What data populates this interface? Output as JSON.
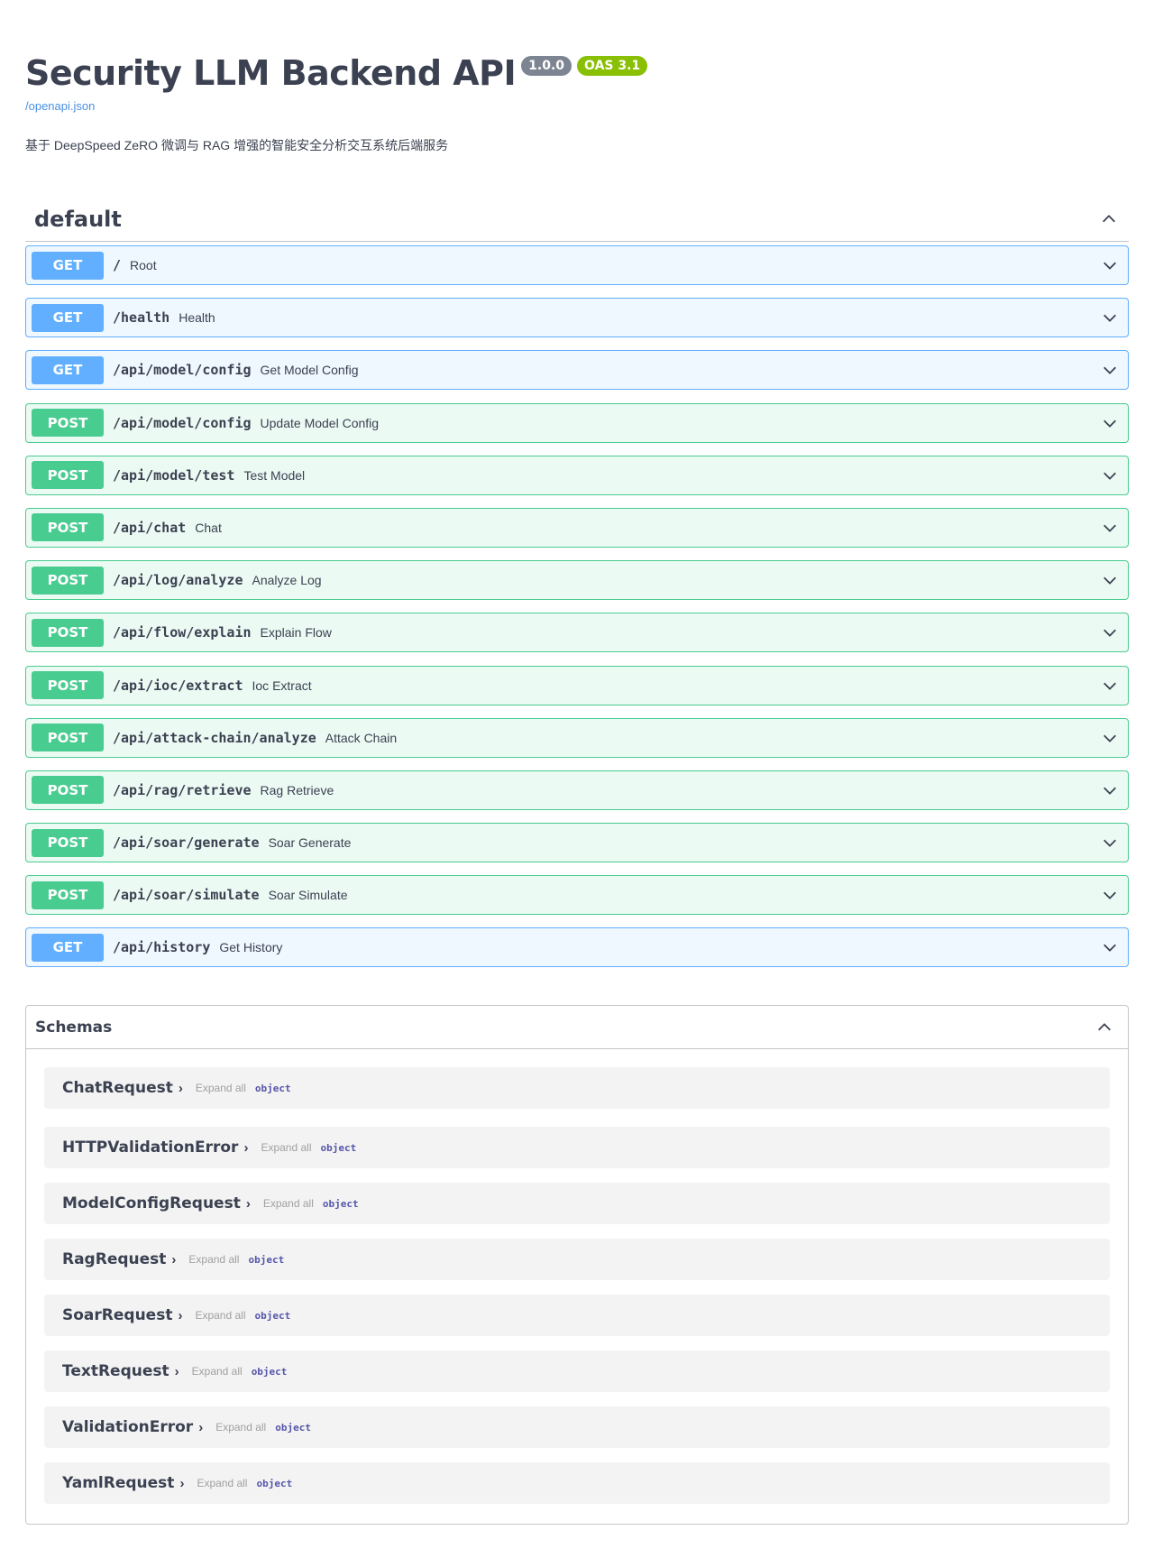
{
  "info": {
    "title": "Security LLM Backend API",
    "version": "1.0.0",
    "oas": "OAS 3.1",
    "openapi_link": "/openapi.json",
    "description": "基于 DeepSpeed ZeRO 微调与 RAG 增强的智能安全分析交互系统后端服务"
  },
  "tag": {
    "name": "default"
  },
  "operations": [
    {
      "method": "GET",
      "path": "/",
      "summary": "Root"
    },
    {
      "method": "GET",
      "path": "/health",
      "summary": "Health"
    },
    {
      "method": "GET",
      "path": "/api/model/config",
      "summary": "Get Model Config"
    },
    {
      "method": "POST",
      "path": "/api/model/config",
      "summary": "Update Model Config"
    },
    {
      "method": "POST",
      "path": "/api/model/test",
      "summary": "Test Model"
    },
    {
      "method": "POST",
      "path": "/api/chat",
      "summary": "Chat"
    },
    {
      "method": "POST",
      "path": "/api/log/analyze",
      "summary": "Analyze Log"
    },
    {
      "method": "POST",
      "path": "/api/flow/explain",
      "summary": "Explain Flow"
    },
    {
      "method": "POST",
      "path": "/api/ioc/extract",
      "summary": "Ioc Extract"
    },
    {
      "method": "POST",
      "path": "/api/attack-chain/analyze",
      "summary": "Attack Chain"
    },
    {
      "method": "POST",
      "path": "/api/rag/retrieve",
      "summary": "Rag Retrieve"
    },
    {
      "method": "POST",
      "path": "/api/soar/generate",
      "summary": "Soar Generate"
    },
    {
      "method": "POST",
      "path": "/api/soar/simulate",
      "summary": "Soar Simulate"
    },
    {
      "method": "GET",
      "path": "/api/history",
      "summary": "Get History"
    }
  ],
  "schemas": {
    "title": "Schemas",
    "expand_label": "Expand all",
    "type_label": "object",
    "items": [
      {
        "name": "ChatRequest"
      },
      {
        "name": "HTTPValidationError"
      },
      {
        "name": "ModelConfigRequest"
      },
      {
        "name": "RagRequest"
      },
      {
        "name": "SoarRequest"
      },
      {
        "name": "TextRequest"
      },
      {
        "name": "ValidationError"
      },
      {
        "name": "YamlRequest"
      }
    ]
  },
  "colors": {
    "get": "#61affe",
    "post": "#49cc90",
    "version_badge": "#7d8492",
    "oas_badge": "#89bf04",
    "link": "#4990e2"
  },
  "icons": {
    "collapse": "chevron-up-icon",
    "expand": "chevron-down-icon",
    "schema_expand": "chevron-right-icon"
  }
}
